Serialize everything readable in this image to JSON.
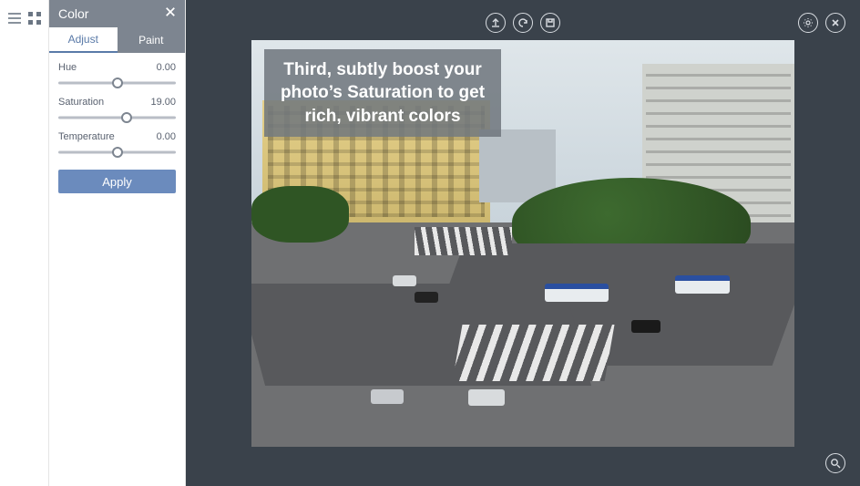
{
  "rail": {
    "list_icon": "list-icon",
    "grid_icon": "grid-icon"
  },
  "panel": {
    "title": "Color",
    "tabs": {
      "adjust": "Adjust",
      "paint": "Paint",
      "active": "adjust"
    },
    "sliders": {
      "hue": {
        "label": "Hue",
        "value_text": "0.00",
        "percent": 50
      },
      "saturation": {
        "label": "Saturation",
        "value_text": "19.00",
        "percent": 58
      },
      "temperature": {
        "label": "Temperature",
        "value_text": "0.00",
        "percent": 50
      }
    },
    "apply_label": "Apply"
  },
  "editor": {
    "overlay": "Third, subtly boost your photo’s Saturation to get rich, vibrant colors",
    "toolbar": {
      "upload": "upload-icon",
      "undo": "undo-icon",
      "save": "save-icon",
      "settings": "gear-icon",
      "close": "close-icon",
      "zoom": "zoom-icon"
    }
  }
}
